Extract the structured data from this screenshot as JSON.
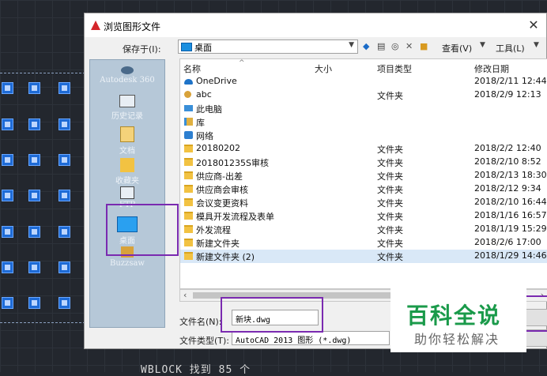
{
  "dialog": {
    "title": "浏览图形文件",
    "close_glyph": "✕"
  },
  "lookin": {
    "label": "保存于(I):",
    "value": "桌面"
  },
  "toolbar": {
    "view_menu": "查看(V)",
    "tools_menu": "工具(L)"
  },
  "places": [
    {
      "label": "Autodesk 360"
    },
    {
      "label": "历史记录"
    },
    {
      "label": "文档"
    },
    {
      "label": "收藏夹"
    },
    {
      "label": "FTP"
    },
    {
      "label": "桌面"
    },
    {
      "label": "Buzzsaw"
    }
  ],
  "columns": {
    "name": "名称",
    "size": "大小",
    "type": "项目类型",
    "date": "修改日期"
  },
  "files": [
    {
      "name": "OneDrive",
      "type": "",
      "date": "2018/2/11 12:44",
      "icon": "cloud-icon"
    },
    {
      "name": "abc",
      "type": "文件夹",
      "date": "2018/2/9 12:13",
      "icon": "user-folder-icon"
    },
    {
      "name": "此电脑",
      "type": "",
      "date": "",
      "icon": "computer-icon"
    },
    {
      "name": "库",
      "type": "",
      "date": "",
      "icon": "library-icon"
    },
    {
      "name": "网络",
      "type": "",
      "date": "",
      "icon": "network-icon"
    },
    {
      "name": "20180202",
      "type": "文件夹",
      "date": "2018/2/2 12:40",
      "icon": "folder-icon"
    },
    {
      "name": "201801235S审核",
      "type": "文件夹",
      "date": "2018/2/10 8:52",
      "icon": "folder-icon"
    },
    {
      "name": "供应商-出差",
      "type": "文件夹",
      "date": "2018/2/13 18:30",
      "icon": "folder-icon"
    },
    {
      "name": "供应商会审核",
      "type": "文件夹",
      "date": "2018/2/12 9:34",
      "icon": "folder-icon"
    },
    {
      "name": "会议变更资料",
      "type": "文件夹",
      "date": "2018/2/10 16:44",
      "icon": "folder-icon"
    },
    {
      "name": "模具开发流程及表单",
      "type": "文件夹",
      "date": "2018/1/16 16:57",
      "icon": "folder-icon"
    },
    {
      "name": "外发流程",
      "type": "文件夹",
      "date": "2018/1/19 15:29",
      "icon": "folder-icon"
    },
    {
      "name": "新建文件夹",
      "type": "文件夹",
      "date": "2018/2/6 17:00",
      "icon": "folder-icon"
    },
    {
      "name": "新建文件夹 (2)",
      "type": "文件夹",
      "date": "2018/1/29 14:46",
      "icon": "folder-icon"
    }
  ],
  "filename": {
    "label": "文件名(N):",
    "value": "新块.dwg"
  },
  "filetype": {
    "label": "文件类型(T):",
    "value": "AutoCAD 2013 图形 (*.dwg)"
  },
  "watermark": {
    "title": "百科全说",
    "subtitle": "助你轻松解决"
  },
  "cad_status": "WBLOCK 找到 85 个",
  "colors": {
    "highlight": "#7a2ab0",
    "cad_block": "#1e6bd6",
    "watermark_green": "#1a9a4a"
  }
}
